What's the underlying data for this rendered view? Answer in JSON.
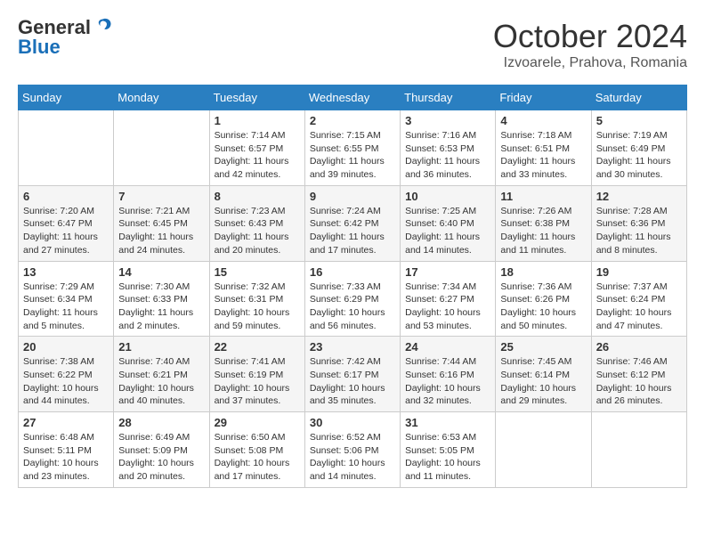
{
  "header": {
    "logo_general": "General",
    "logo_blue": "Blue",
    "month": "October 2024",
    "location": "Izvoarele, Prahova, Romania"
  },
  "days_of_week": [
    "Sunday",
    "Monday",
    "Tuesday",
    "Wednesday",
    "Thursday",
    "Friday",
    "Saturday"
  ],
  "weeks": [
    [
      {
        "day": "",
        "info": ""
      },
      {
        "day": "",
        "info": ""
      },
      {
        "day": "1",
        "info": "Sunrise: 7:14 AM\nSunset: 6:57 PM\nDaylight: 11 hours and 42 minutes."
      },
      {
        "day": "2",
        "info": "Sunrise: 7:15 AM\nSunset: 6:55 PM\nDaylight: 11 hours and 39 minutes."
      },
      {
        "day": "3",
        "info": "Sunrise: 7:16 AM\nSunset: 6:53 PM\nDaylight: 11 hours and 36 minutes."
      },
      {
        "day": "4",
        "info": "Sunrise: 7:18 AM\nSunset: 6:51 PM\nDaylight: 11 hours and 33 minutes."
      },
      {
        "day": "5",
        "info": "Sunrise: 7:19 AM\nSunset: 6:49 PM\nDaylight: 11 hours and 30 minutes."
      }
    ],
    [
      {
        "day": "6",
        "info": "Sunrise: 7:20 AM\nSunset: 6:47 PM\nDaylight: 11 hours and 27 minutes."
      },
      {
        "day": "7",
        "info": "Sunrise: 7:21 AM\nSunset: 6:45 PM\nDaylight: 11 hours and 24 minutes."
      },
      {
        "day": "8",
        "info": "Sunrise: 7:23 AM\nSunset: 6:43 PM\nDaylight: 11 hours and 20 minutes."
      },
      {
        "day": "9",
        "info": "Sunrise: 7:24 AM\nSunset: 6:42 PM\nDaylight: 11 hours and 17 minutes."
      },
      {
        "day": "10",
        "info": "Sunrise: 7:25 AM\nSunset: 6:40 PM\nDaylight: 11 hours and 14 minutes."
      },
      {
        "day": "11",
        "info": "Sunrise: 7:26 AM\nSunset: 6:38 PM\nDaylight: 11 hours and 11 minutes."
      },
      {
        "day": "12",
        "info": "Sunrise: 7:28 AM\nSunset: 6:36 PM\nDaylight: 11 hours and 8 minutes."
      }
    ],
    [
      {
        "day": "13",
        "info": "Sunrise: 7:29 AM\nSunset: 6:34 PM\nDaylight: 11 hours and 5 minutes."
      },
      {
        "day": "14",
        "info": "Sunrise: 7:30 AM\nSunset: 6:33 PM\nDaylight: 11 hours and 2 minutes."
      },
      {
        "day": "15",
        "info": "Sunrise: 7:32 AM\nSunset: 6:31 PM\nDaylight: 10 hours and 59 minutes."
      },
      {
        "day": "16",
        "info": "Sunrise: 7:33 AM\nSunset: 6:29 PM\nDaylight: 10 hours and 56 minutes."
      },
      {
        "day": "17",
        "info": "Sunrise: 7:34 AM\nSunset: 6:27 PM\nDaylight: 10 hours and 53 minutes."
      },
      {
        "day": "18",
        "info": "Sunrise: 7:36 AM\nSunset: 6:26 PM\nDaylight: 10 hours and 50 minutes."
      },
      {
        "day": "19",
        "info": "Sunrise: 7:37 AM\nSunset: 6:24 PM\nDaylight: 10 hours and 47 minutes."
      }
    ],
    [
      {
        "day": "20",
        "info": "Sunrise: 7:38 AM\nSunset: 6:22 PM\nDaylight: 10 hours and 44 minutes."
      },
      {
        "day": "21",
        "info": "Sunrise: 7:40 AM\nSunset: 6:21 PM\nDaylight: 10 hours and 40 minutes."
      },
      {
        "day": "22",
        "info": "Sunrise: 7:41 AM\nSunset: 6:19 PM\nDaylight: 10 hours and 37 minutes."
      },
      {
        "day": "23",
        "info": "Sunrise: 7:42 AM\nSunset: 6:17 PM\nDaylight: 10 hours and 35 minutes."
      },
      {
        "day": "24",
        "info": "Sunrise: 7:44 AM\nSunset: 6:16 PM\nDaylight: 10 hours and 32 minutes."
      },
      {
        "day": "25",
        "info": "Sunrise: 7:45 AM\nSunset: 6:14 PM\nDaylight: 10 hours and 29 minutes."
      },
      {
        "day": "26",
        "info": "Sunrise: 7:46 AM\nSunset: 6:12 PM\nDaylight: 10 hours and 26 minutes."
      }
    ],
    [
      {
        "day": "27",
        "info": "Sunrise: 6:48 AM\nSunset: 5:11 PM\nDaylight: 10 hours and 23 minutes."
      },
      {
        "day": "28",
        "info": "Sunrise: 6:49 AM\nSunset: 5:09 PM\nDaylight: 10 hours and 20 minutes."
      },
      {
        "day": "29",
        "info": "Sunrise: 6:50 AM\nSunset: 5:08 PM\nDaylight: 10 hours and 17 minutes."
      },
      {
        "day": "30",
        "info": "Sunrise: 6:52 AM\nSunset: 5:06 PM\nDaylight: 10 hours and 14 minutes."
      },
      {
        "day": "31",
        "info": "Sunrise: 6:53 AM\nSunset: 5:05 PM\nDaylight: 10 hours and 11 minutes."
      },
      {
        "day": "",
        "info": ""
      },
      {
        "day": "",
        "info": ""
      }
    ]
  ]
}
